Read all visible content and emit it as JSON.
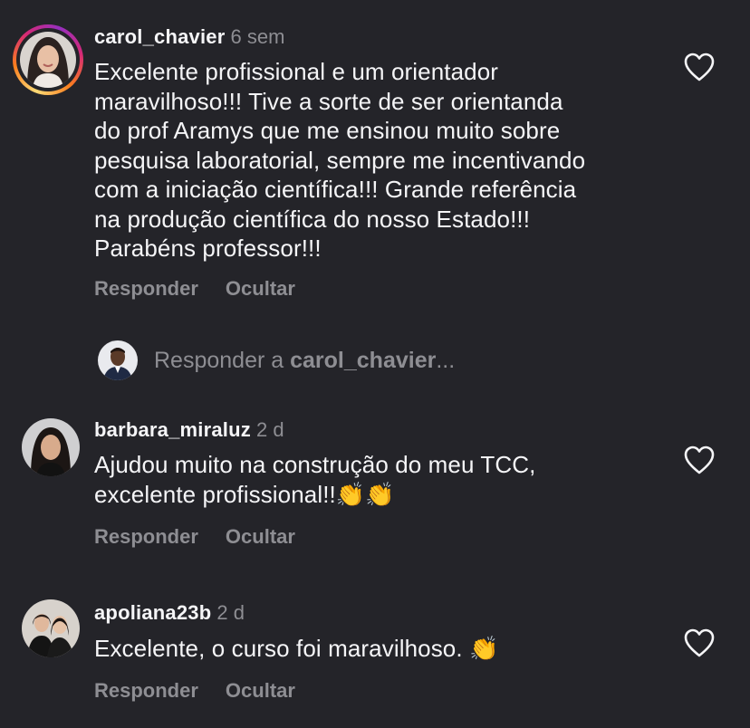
{
  "colors": {
    "background": "#242429",
    "text": "#f5f5f7",
    "muted": "#8e8e93"
  },
  "comments": [
    {
      "username": "carol_chavier",
      "time": "6 sem",
      "text": "Excelente profissional e um orientador\nmaravilhoso!!! Tive a sorte de ser orientanda\ndo prof Aramys que me ensinou muito sobre\npesquisa laboratorial, sempre me incentivando\ncom a iniciação científica!!! Grande referência\nna produção científica do nosso Estado!!!\nParabéns professor!!!",
      "reply_label": "Responder",
      "hide_label": "Ocultar",
      "like_icon": "heart-outline-icon"
    },
    {
      "username": "barbara_miraluz",
      "time": "2 d",
      "text": "Ajudou muito na construção do meu TCC,\nexcelente profissional!!👏👏",
      "reply_label": "Responder",
      "hide_label": "Ocultar",
      "like_icon": "heart-outline-icon"
    },
    {
      "username": "apoliana23b",
      "time": "2 d",
      "text": "Excelente, o curso foi maravilhoso. 👏",
      "reply_label": "Responder",
      "hide_label": "Ocultar",
      "like_icon": "heart-outline-icon"
    }
  ],
  "reply_input": {
    "prefix": "Responder a ",
    "target": "carol_chavier",
    "suffix": "..."
  }
}
